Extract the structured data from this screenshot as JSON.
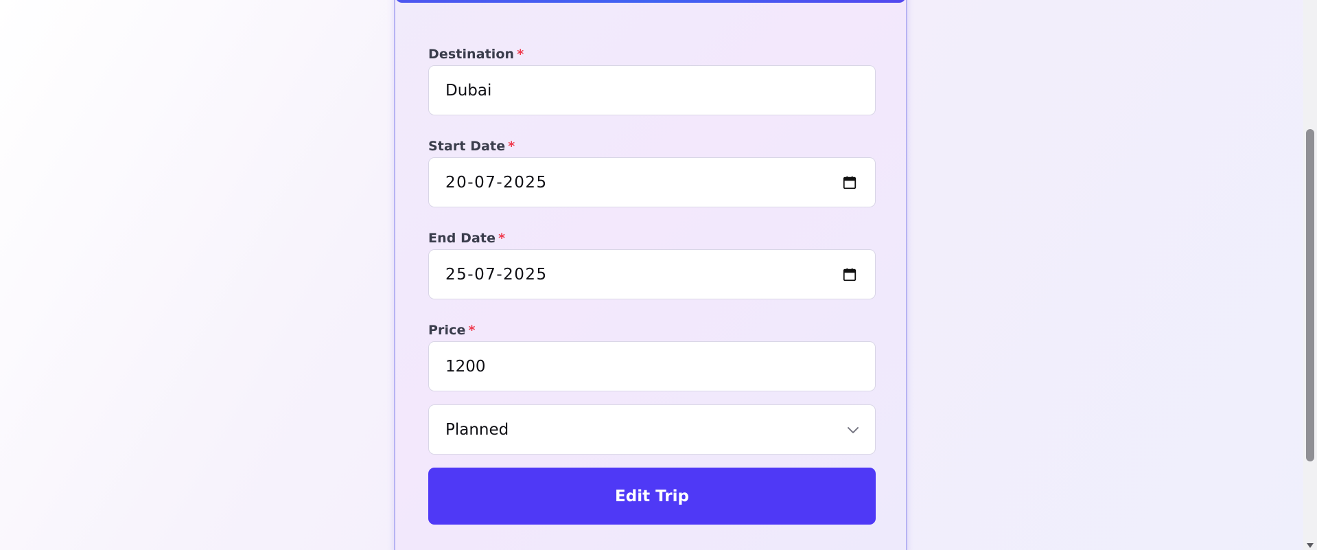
{
  "form": {
    "destination": {
      "label": "Destination",
      "required_mark": "*",
      "value": "Dubai"
    },
    "start_date": {
      "label": "Start Date",
      "required_mark": "*",
      "value": "20-07-2025"
    },
    "end_date": {
      "label": "End Date",
      "required_mark": "*",
      "value": "25-07-2025"
    },
    "price": {
      "label": "Price",
      "required_mark": "*",
      "value": "1200"
    },
    "status": {
      "selected": "Planned"
    },
    "submit_label": "Edit Trip"
  },
  "icons": {
    "date_picker": "calendar-icon",
    "select_arrow": "chevron-down-icon",
    "scroll_down": "arrow-down-icon"
  },
  "colors": {
    "accent": "#4f39f6",
    "topbar": "#4d56f0",
    "required": "#ef3b4f",
    "card_border": "#b7b3f3"
  }
}
